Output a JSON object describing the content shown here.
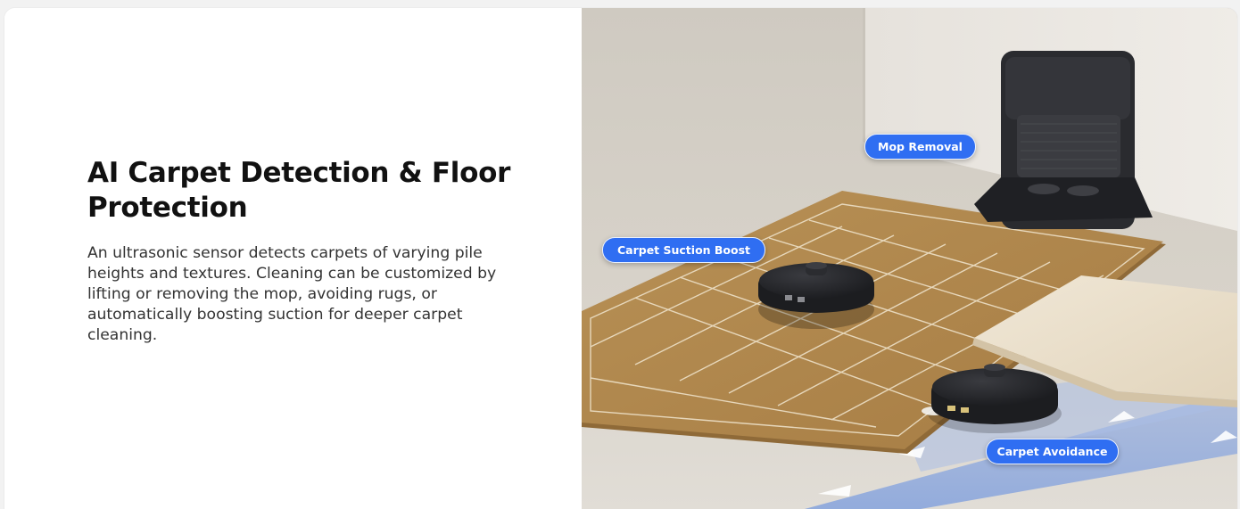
{
  "feature": {
    "title": "AI Carpet Detection & Floor Protection",
    "description": "An ultrasonic sensor detects carpets of varying pile heights and textures. Cleaning can be customized by lifting or removing the mop, avoiding rugs, or automatically boosting suction for deeper carpet cleaning."
  },
  "callouts": {
    "mop_removal": "Mop Removal",
    "carpet_suction_boost": "Carpet Suction Boost",
    "carpet_avoidance": "Carpet Avoidance"
  },
  "colors": {
    "callout_blue": "#2f6ef2",
    "carpet": "#b38a4f",
    "robot": "#1e1f22",
    "floor": "#d9d4cb"
  }
}
